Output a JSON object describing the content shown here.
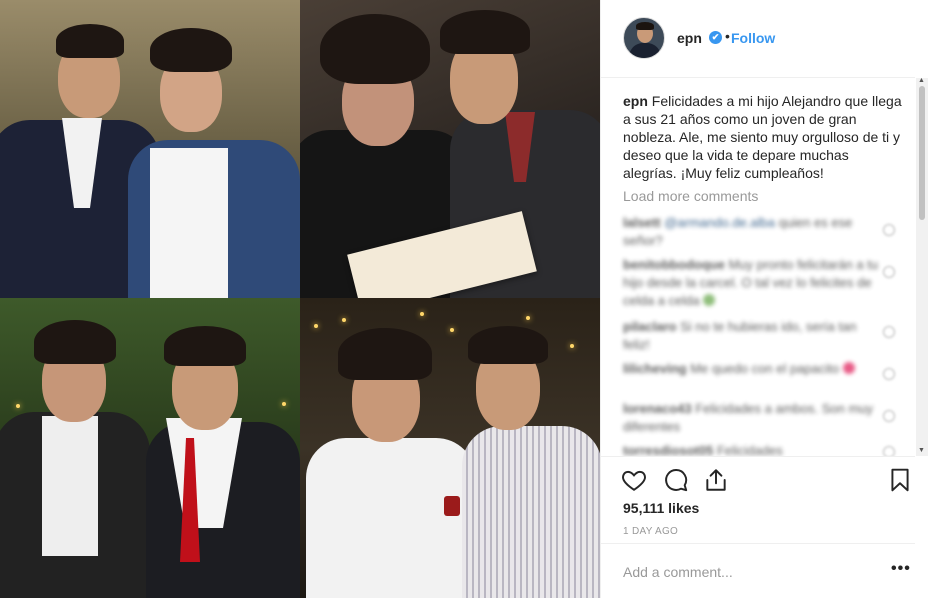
{
  "post": {
    "username": "epn",
    "verified_mark": "✔",
    "separator": "•",
    "follow_label": "Follow",
    "caption_username": "epn",
    "caption_text": "Felicidades a mi hijo Alejandro que llega a sus 21 años como un joven de gran nobleza. Ale, me siento muy orgulloso de ti y deseo que la vida te depare muchas alegrías. ¡Muy feliz cumpleaños!",
    "load_more_label": "Load more comments",
    "likes": "95,111 likes",
    "date": "1 DAY AGO",
    "add_comment_placeholder": "Add a comment...",
    "more_label": "•••"
  },
  "comments": [
    {
      "user": "lalsett",
      "mention": "@armando.de.alba",
      "text": "quien es ese señor?"
    },
    {
      "user": "benitobbodoque",
      "text": "Muy pronto felicitarán a tu hijo desde la carcel. O tal vez lo felicites de celda a celda"
    },
    {
      "user": "pilaclaro",
      "text": "Si no te hubieras ido, sería tan feliz!"
    },
    {
      "user": "lilicheving",
      "text": "Me quedo con el papacito"
    },
    {
      "user": "lorenaco43",
      "text": "Felicidades a ambos. Son muy diferentes"
    },
    {
      "user": "torresdiosot05",
      "text": "Felicidades"
    }
  ],
  "icons": {
    "like": "heart-icon",
    "comment": "speech-bubble-icon",
    "share": "share-icon",
    "save": "bookmark-icon",
    "verified": "verified-badge-icon"
  },
  "colors": {
    "accent": "#3897f0",
    "text": "#262626",
    "muted": "#999999",
    "border": "#efefef"
  }
}
